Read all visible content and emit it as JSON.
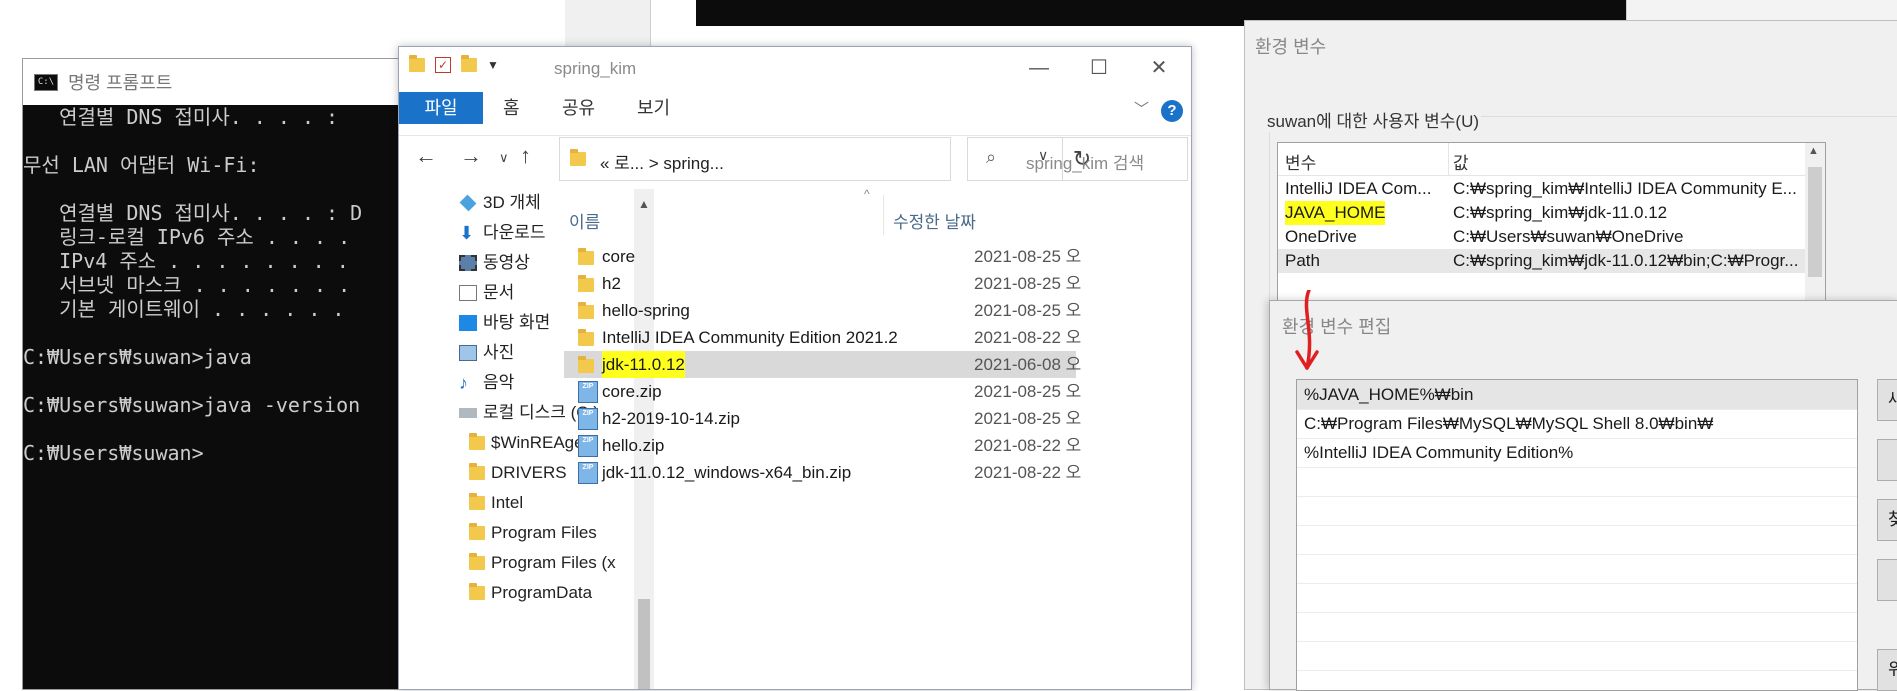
{
  "cmd": {
    "title": "명령 프롬프트",
    "lines": [
      "   연결별 DNS 접미사. . . . :",
      "",
      "무선 LAN 어댑터 Wi-Fi:",
      "",
      "   연결별 DNS 접미사. . . . : D",
      "   링크-로컬 IPv6 주소 . . . .",
      "   IPv4 주소 . . . . . . . .",
      "   서브넷 마스크 . . . . . . .",
      "   기본 게이트웨이 . . . . . .",
      "",
      "C:₩Users₩suwan>java",
      "",
      "C:₩Users₩suwan>java -version",
      "",
      "C:₩Users₩suwan>"
    ]
  },
  "explorer": {
    "title": "spring_kim",
    "ribbon_tabs": [
      "파일",
      "홈",
      "공유",
      "보기"
    ],
    "address": "«  로...  >  spring...",
    "search_placeholder": "spring_kim 검색",
    "nav_items": [
      "3D 개체",
      "다운로드",
      "동영상",
      "문서",
      "바탕 화면",
      "사진",
      "음악",
      "로컬 디스크 (C:)",
      "$WinREAgent",
      "DRIVERS",
      "Intel",
      "Program Files",
      "Program Files (x",
      "ProgramData"
    ],
    "columns": {
      "name": "이름",
      "date": "수정한 날짜"
    },
    "files": [
      {
        "name": "core",
        "date": "2021-08-25 오",
        "type": "folder"
      },
      {
        "name": "h2",
        "date": "2021-08-25 오",
        "type": "folder"
      },
      {
        "name": "hello-spring",
        "date": "2021-08-25 오",
        "type": "folder"
      },
      {
        "name": "IntelliJ IDEA Community Edition 2021.2",
        "date": "2021-08-22 오",
        "type": "folder"
      },
      {
        "name": "jdk-11.0.12",
        "date": "2021-06-08 오",
        "type": "folder",
        "selected": true,
        "highlighted": true
      },
      {
        "name": "core.zip",
        "date": "2021-08-25 오",
        "type": "zip"
      },
      {
        "name": "h2-2019-10-14.zip",
        "date": "2021-08-25 오",
        "type": "zip"
      },
      {
        "name": "hello.zip",
        "date": "2021-08-22 오",
        "type": "zip"
      },
      {
        "name": "jdk-11.0.12_windows-x64_bin.zip",
        "date": "2021-08-22 오",
        "type": "zip"
      }
    ]
  },
  "env": {
    "title": "환경 변수",
    "user_group_label": "suwan에 대한 사용자 변수(U)",
    "headers": {
      "var": "변수",
      "val": "값"
    },
    "rows": [
      {
        "var": "IntelliJ IDEA Com...",
        "val": "C:₩spring_kim₩IntelliJ IDEA Community E..."
      },
      {
        "var": "JAVA_HOME",
        "val": "C:₩spring_kim₩jdk-11.0.12",
        "highlighted": true
      },
      {
        "var": "OneDrive",
        "val": "C:₩Users₩suwan₩OneDrive"
      },
      {
        "var": "Path",
        "val": "C:₩spring_kim₩jdk-11.0.12₩bin;C:₩Progr...",
        "selected": true
      }
    ]
  },
  "edit": {
    "title": "환경 변수 편집",
    "entries": [
      "%JAVA_HOME%₩bin",
      "C:₩Program Files₩MySQL₩MySQL Shell 8.0₩bin₩",
      "%IntelliJ IDEA Community Edition%"
    ],
    "buttons": [
      "새",
      "",
      "찾",
      "",
      "위"
    ]
  },
  "colors": {
    "highlight": "#ffff1e",
    "accent": "#1a73c9",
    "annotation": "#e02020"
  }
}
